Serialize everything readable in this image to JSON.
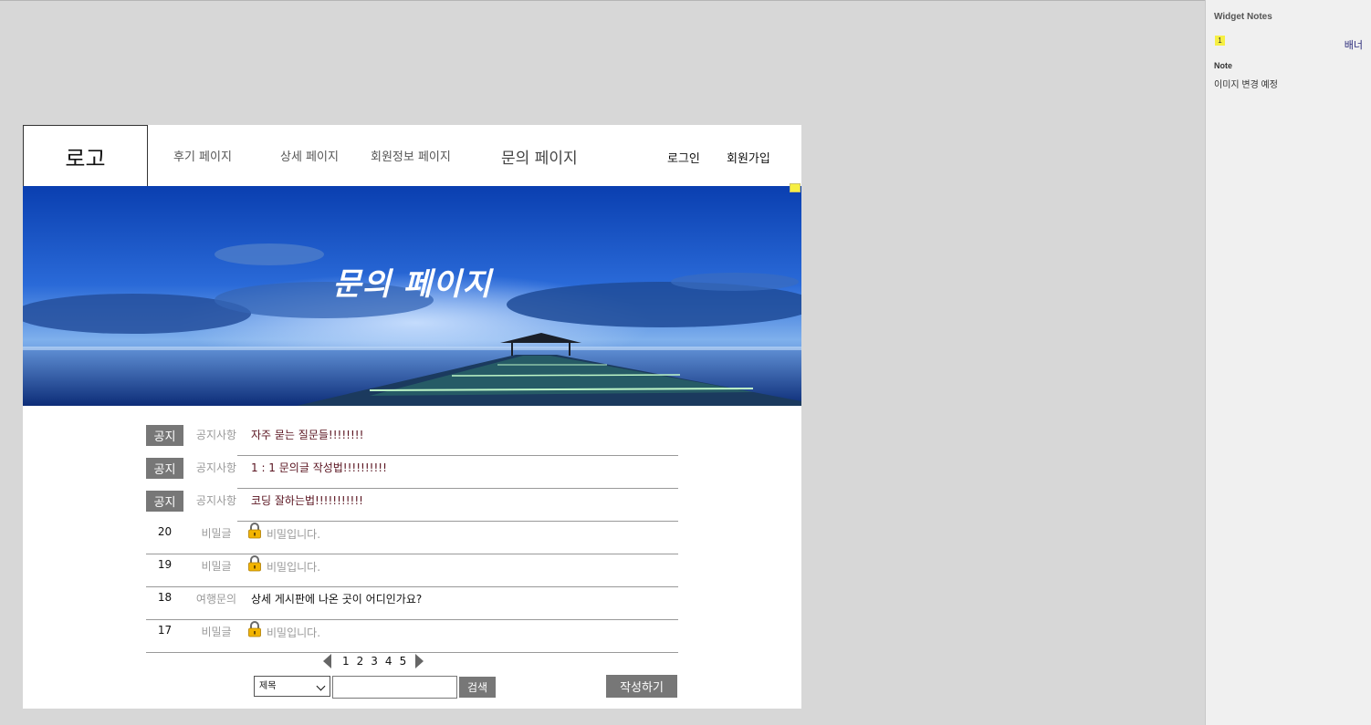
{
  "header": {
    "logo": "로고",
    "nav": [
      "후기 페이지",
      "상세 페이지",
      "회원정보 페이지",
      "문의 페이지"
    ],
    "login": "로그인",
    "signup": "회원가입"
  },
  "banner": {
    "title": "문의 페이지"
  },
  "board": {
    "rows": [
      {
        "kind": "notice",
        "badge": "공지",
        "category": "공지사항",
        "title": "자주 묻는 질문들!!!!!!!!"
      },
      {
        "kind": "notice",
        "badge": "공지",
        "category": "공지사항",
        "title": "1 : 1 문의글 작성법!!!!!!!!!!"
      },
      {
        "kind": "notice",
        "badge": "공지",
        "category": "공지사항",
        "title": "코딩 잘하는법!!!!!!!!!!!"
      },
      {
        "kind": "secret",
        "number": "20",
        "category": "비밀글",
        "title": "비밀입니다."
      },
      {
        "kind": "secret",
        "number": "19",
        "category": "비밀글",
        "title": "비밀입니다."
      },
      {
        "kind": "post",
        "number": "18",
        "category": "여행문의",
        "title": "상세 게시판에 나온 곳이 어디인가요?"
      },
      {
        "kind": "secret",
        "number": "17",
        "category": "비밀글",
        "title": "비밀입니다."
      }
    ]
  },
  "pagination": {
    "pages": [
      "1",
      "2",
      "3",
      "4",
      "5"
    ]
  },
  "search": {
    "select_value": "제목",
    "input_value": "",
    "button": "검색"
  },
  "write_button": "작성하기",
  "widget_notes": {
    "heading": "Widget Notes",
    "index": "1",
    "widget_name": "배너",
    "note_label": "Note",
    "note_text": "이미지 변경 예정"
  },
  "colors": {
    "badge_bg": "#777777",
    "note_yellow": "#f6ef43",
    "notice_title": "#5a1420"
  }
}
